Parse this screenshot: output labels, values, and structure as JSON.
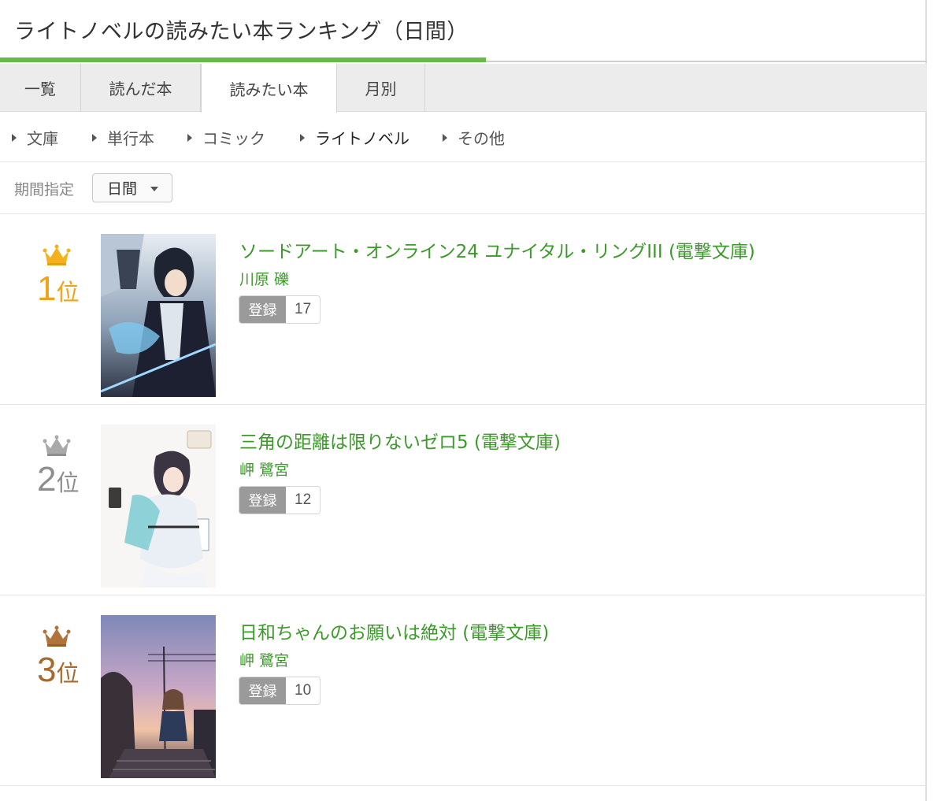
{
  "header": {
    "title": "ライトノベルの読みたい本ランキング（日間）"
  },
  "tabs": [
    {
      "label": "一覧",
      "active": false
    },
    {
      "label": "読んだ本",
      "active": false
    },
    {
      "label": "読みたい本",
      "active": true
    },
    {
      "label": "月別",
      "active": false
    }
  ],
  "categories": [
    {
      "label": "文庫",
      "active": false
    },
    {
      "label": "単行本",
      "active": false
    },
    {
      "label": "コミック",
      "active": false
    },
    {
      "label": "ライトノベル",
      "active": true
    },
    {
      "label": "その他",
      "active": false
    }
  ],
  "period": {
    "label": "期間指定",
    "selected": "日間"
  },
  "colors": {
    "accent": "#66bb46",
    "link": "#3c9a2a",
    "gold": "#f0a218",
    "silver": "#8e8e8e",
    "bronze": "#a86a2e"
  },
  "ranking": [
    {
      "rank": "1",
      "rank_unit": "位",
      "crown": "gold-crown-icon",
      "title": "ソードアート・オンライン24 ユナイタル・リングIII (電撃文庫)",
      "author": "川原 礫",
      "reg_label": "登録",
      "reg_count": "17"
    },
    {
      "rank": "2",
      "rank_unit": "位",
      "crown": "silver-crown-icon",
      "title": "三角の距離は限りないゼロ5 (電撃文庫)",
      "author": "岬 鷺宮",
      "reg_label": "登録",
      "reg_count": "12"
    },
    {
      "rank": "3",
      "rank_unit": "位",
      "crown": "bronze-crown-icon",
      "title": "日和ちゃんのお願いは絶対 (電撃文庫)",
      "author": "岬 鷺宮",
      "reg_label": "登録",
      "reg_count": "10"
    }
  ]
}
